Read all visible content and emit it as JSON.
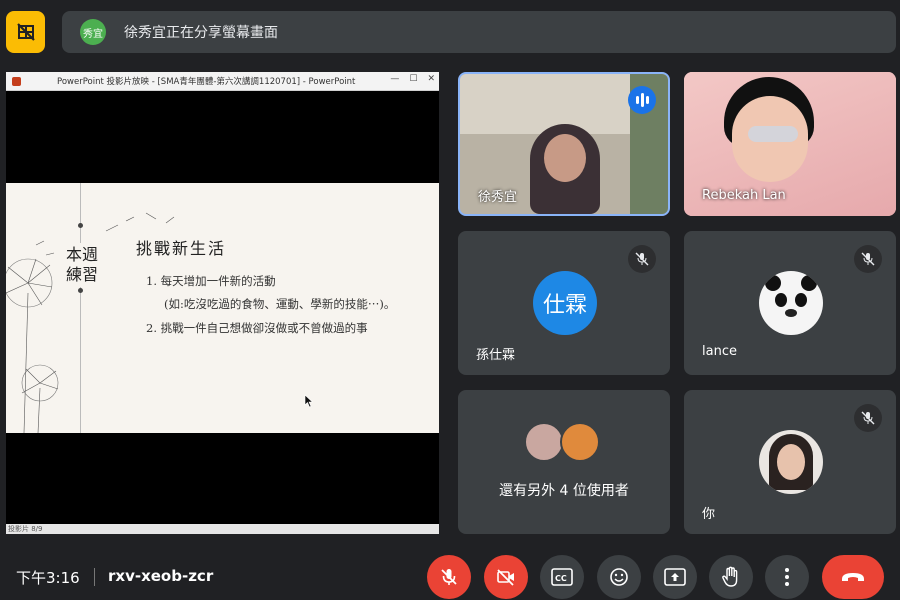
{
  "top": {
    "banner_avatar": "秀宜",
    "banner_text": "徐秀宜正在分享螢幕畫面"
  },
  "presentation": {
    "window_title": "PowerPoint 投影片放映 - [SMA青年團體-第六次講調1120701] - PowerPoint",
    "side_title_1": "本週",
    "side_title_2": "練習",
    "heading": "挑戰新生活",
    "item_1": "1.  每天增加一件新的活動",
    "item_1b": "(如:吃沒吃過的食物、運動、學新的技能⋯)。",
    "item_2": "2.  挑戰一件自己想做卻沒做或不曾做過的事",
    "status": "投影片 8/9"
  },
  "participants": [
    {
      "name": "徐秀宜",
      "speaking": true
    },
    {
      "name": "Rebekah Lan",
      "muted": false
    },
    {
      "name": "孫仕霖",
      "avatar_text": "仕霖",
      "muted": true
    },
    {
      "name": "lance",
      "muted": true
    },
    {
      "name": "還有另外 4 位使用者"
    },
    {
      "name": "你",
      "muted": true
    }
  ],
  "bottom": {
    "time": "下午3:16",
    "meeting_code": "rxv-xeob-zcr"
  },
  "icons": [
    "hide-self-icon",
    "mic-off-icon",
    "cam-off-icon",
    "captions-icon",
    "emoji-icon",
    "present-icon",
    "raise-hand-icon",
    "more-icon",
    "end-call-icon"
  ],
  "colors": {
    "accent": "#1a73e8",
    "danger": "#ea4335",
    "warn": "#fbbc04"
  }
}
